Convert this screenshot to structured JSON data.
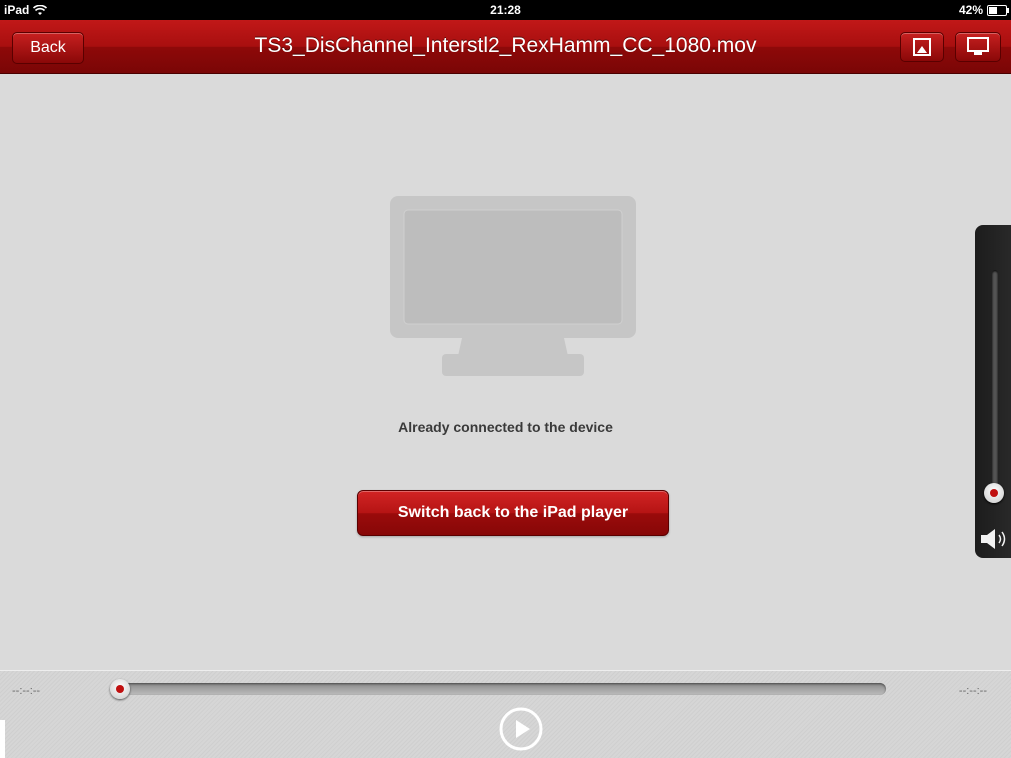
{
  "status_bar": {
    "device": "iPad",
    "time": "21:28",
    "battery": "42%",
    "battery_level": 0.42
  },
  "navbar": {
    "back_label": "Back",
    "title": "TS3_DisChannel_Interstl2_RexHamm_CC_1080.mov",
    "bookmark_icon": "bookmark-icon",
    "airplay_icon": "monitor-icon"
  },
  "main": {
    "device_icon": "monitor-icon",
    "message": "Already connected to the device",
    "switch_button_label": "Switch back to the iPad player"
  },
  "volume": {
    "level": 0.0,
    "speaker_icon": "speaker-icon"
  },
  "player": {
    "time_elapsed": "--:--:--",
    "time_remaining": "--:--:--",
    "progress": 0.0,
    "play_icon": "play-icon"
  },
  "colors": {
    "accent": "#a80f0f",
    "background": "#dadada"
  }
}
